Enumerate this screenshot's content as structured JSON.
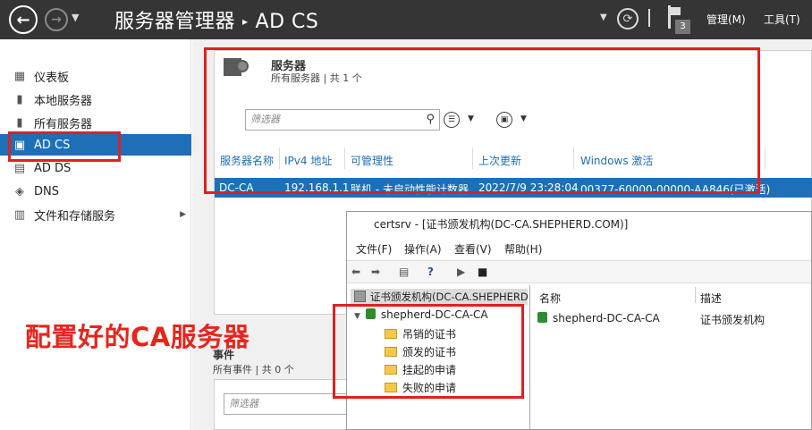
{
  "titlebar": {
    "app_title": "服务器管理器",
    "separator": "▸",
    "crumb": "AD CS",
    "notification_count": "3",
    "menu_manage": "管理(M)",
    "menu_tools": "工具(T)"
  },
  "sidebar": {
    "items": [
      {
        "label": "仪表板",
        "icon": "dashboard-icon"
      },
      {
        "label": "本地服务器",
        "icon": "local-server-icon"
      },
      {
        "label": "所有服务器",
        "icon": "all-servers-icon"
      },
      {
        "label": "AD CS",
        "icon": "adcs-icon",
        "active": true
      },
      {
        "label": "AD DS",
        "icon": "adds-icon"
      },
      {
        "label": "DNS",
        "icon": "dns-icon"
      },
      {
        "label": "文件和存储服务",
        "icon": "file-storage-icon",
        "has_submenu": true
      }
    ]
  },
  "servers_tile": {
    "title": "服务器",
    "subtitle": "所有服务器 | 共 1 个",
    "filter_placeholder": "筛选器",
    "columns": [
      "服务器名称",
      "IPv4 地址",
      "可管理性",
      "上次更新",
      "Windows 激活"
    ],
    "rows": [
      [
        "DC-CA",
        "192.168.1.1",
        "联机 - 未启动性能计数器",
        "2022/7/9 23:28:04",
        "00377-60000-00000-AA846(已激活)"
      ]
    ]
  },
  "events": {
    "title": "事件",
    "subtitle": "所有事件 | 共 0 个",
    "filter_placeholder": "筛选器"
  },
  "certsrv": {
    "title": "certsrv - [证书颁发机构(DC-CA.SHEPHERD.COM)]",
    "menu": [
      "文件(F)",
      "操作(A)",
      "查看(V)",
      "帮助(H)"
    ],
    "tree_root": "证书颁发机构(DC-CA.SHEPHERD.COM)",
    "ca_node": "shepherd-DC-CA-CA",
    "folders": [
      "吊销的证书",
      "颁发的证书",
      "挂起的申请",
      "失败的申请"
    ],
    "list_headers": [
      "名称",
      "描述"
    ],
    "list_rows": [
      [
        "shepherd-DC-CA-CA",
        "证书颁发机构"
      ]
    ]
  },
  "annotation": {
    "text": "配置好的CA服务器",
    "color": "#e8241c"
  },
  "colors": {
    "accent": "#1e6fb8",
    "titlebar": "#353535"
  }
}
